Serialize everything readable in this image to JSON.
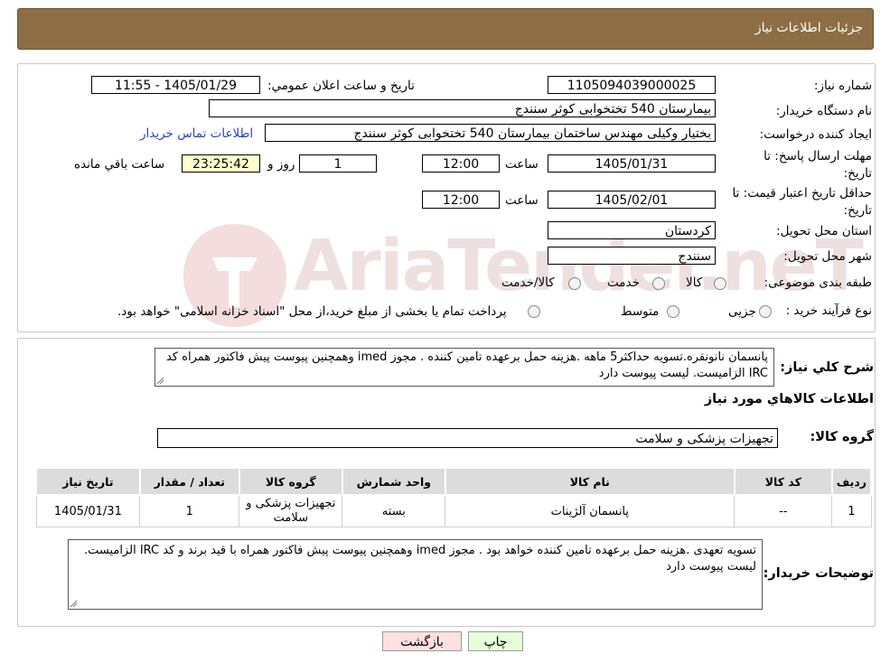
{
  "header": {
    "title": "جزئیات اطلاعات نیاز"
  },
  "form": {
    "need_number_label": "شماره نیاز:",
    "need_number": "1105094039000025",
    "announce_label": "تاریخ و ساعت اعلان عمومي:",
    "announce_value": "1405/01/29 - 11:55",
    "buyer_label": "نام دستگاه خریدار:",
    "buyer_value": "بیمارستان 540 تختخوابی کوثر سنندج",
    "creator_label": "ایجاد کننده درخواست:",
    "creator_value": "بختیار وکیلی مهندس ساختمان بیمارستان 540 تختخوابی کوثر سنندج",
    "contact_link": "اطلاعات تماس خریدار",
    "deadline_label_1": "مهلت ارسال پاسخ: تا",
    "deadline_label_2": "تاریخ:",
    "deadline_date": "1405/01/31",
    "time_label": "ساعت",
    "deadline_time": "12:00",
    "days_value": "1",
    "days_label": "روز و",
    "remaining_time": "23:25:42",
    "remaining_label": "ساعت باقي مانده",
    "validity_label_1": "حداقل تاریخ اعتبار قیمت: تا",
    "validity_label_2": "تاریخ:",
    "validity_date": "1405/02/01",
    "validity_time": "12:00",
    "province_label": "استان محل تحویل:",
    "province_value": "کردستان",
    "city_label": "شهر محل تحویل:",
    "city_value": "سنندج",
    "category_label": "طبقه بندی موضوعی:",
    "category_options": [
      "کالا",
      "خدمت",
      "کالا/خدمت"
    ],
    "purchase_label": "نوع فرآیند خرید :",
    "purchase_options": [
      "جزیی",
      "متوسط"
    ],
    "purchase_note": "پرداخت تمام یا بخشی از مبلغ خرید،از محل \"اسناد خزانه اسلامی\" خواهد بود."
  },
  "summary": {
    "label": "شرح کلي نیاز:",
    "text": "پانسمان نانونقره.تسویه حداکثر5 ماهه .هزینه حمل برعهده تامین کننده . مجوز imed وهمچنین پیوست پیش فاکتور همراه کد IRC  الزامیست. لیست پیوست دارد",
    "goods_info_title": "اطلاعات کالاهاي مورد نیاز",
    "group_label": "گروه کالا:",
    "group_value": "تجهیزات پزشکی و سلامت"
  },
  "table": {
    "headers": [
      "ردیف",
      "کد کالا",
      "نام کالا",
      "واحد شمارش",
      "گروه کالا",
      "تعداد / مقدار",
      "تاریخ نیاز"
    ],
    "rows": [
      [
        "1",
        "--",
        "پانسمان آلژینات",
        "بسته",
        "تجهیزات پزشکی و سلامت",
        "1",
        "1405/01/31"
      ]
    ]
  },
  "buyer_notes": {
    "label": "توضیحات خریدار:",
    "text": "تسویه تعهدی .هزینه حمل برعهده تامین کننده خواهد بود . مجوز imed وهمچنین پیوست پیش فاکتور همراه  با قید برند و کد IRC  الزامیست. لیست پیوست دارد"
  },
  "buttons": {
    "print": "چاپ",
    "back": "بازگشت"
  },
  "watermark": {
    "text": "AriaTender.neT"
  },
  "colors": {
    "header_bg": "#8d6e44",
    "timer_bg": "#ffffcc",
    "print_bg": "#e6ffd9",
    "back_bg": "#ffe0e0",
    "link": "#2a3fd0"
  }
}
